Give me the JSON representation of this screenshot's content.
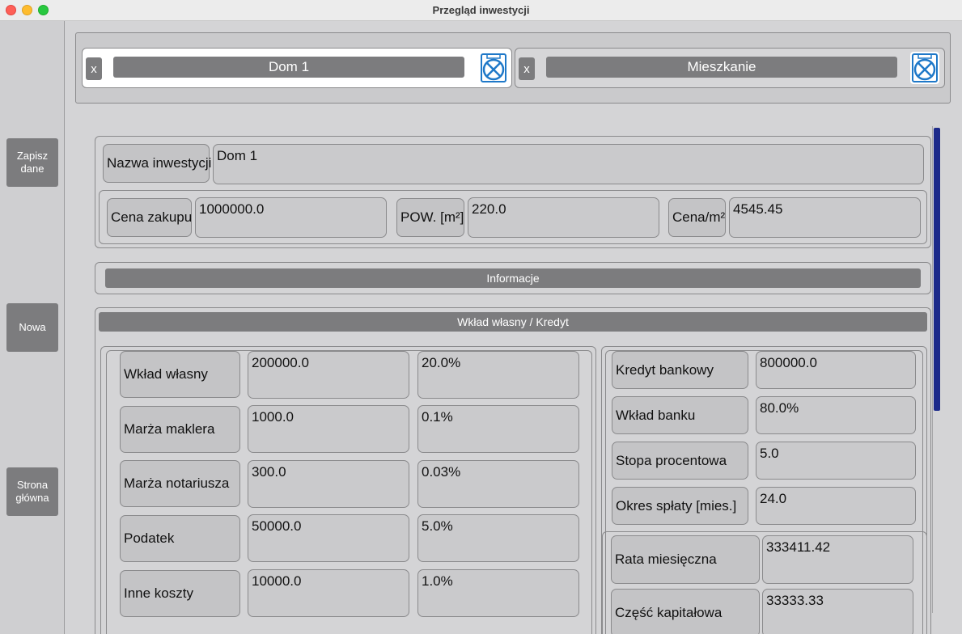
{
  "window": {
    "title": "Przegląd inwestycji"
  },
  "sidebar": {
    "save_label": "Zapisz dane",
    "new_label": "Nowa",
    "home_label": "Strona główna"
  },
  "tabs": [
    {
      "close_label": "x",
      "title": "Dom 1",
      "active": true
    },
    {
      "close_label": "x",
      "title": "Mieszkanie",
      "active": false
    }
  ],
  "investment": {
    "name_label": "Nazwa inwestycji",
    "name_value": "Dom 1",
    "price_label": "Cena zakupu",
    "price_value": "1000000.0",
    "area_label": "POW. [m²]",
    "area_value": "220.0",
    "price_per_m2_label": "Cena/m²",
    "price_per_m2_value": "4545.45"
  },
  "info_bar": "Informacje",
  "equity_section": {
    "title": "Wkład własny / Kredyt",
    "rows": [
      {
        "label": "Wkład własny",
        "amount": "200000.0",
        "percent": "20.0%"
      },
      {
        "label": "Marża maklera",
        "amount": "1000.0",
        "percent": "0.1%"
      },
      {
        "label": "Marża notariusza",
        "amount": "300.0",
        "percent": "0.03%"
      },
      {
        "label": "Podatek",
        "amount": "50000.0",
        "percent": "5.0%"
      },
      {
        "label": "Inne koszty",
        "amount": "10000.0",
        "percent": "1.0%"
      }
    ],
    "credit": [
      {
        "label": "Kredyt bankowy",
        "value": "800000.0"
      },
      {
        "label": "Wkład banku",
        "value": "80.0%"
      },
      {
        "label": "Stopa procentowa",
        "value": "5.0"
      },
      {
        "label": "Okres spłaty [mies.]",
        "value": "24.0"
      }
    ],
    "installment": [
      {
        "label": "Rata miesięczna",
        "value": "333411.42"
      },
      {
        "label": "Część kapitałowa",
        "value": "33333.33"
      }
    ]
  },
  "colors": {
    "button": "#7c7c7e",
    "scrollbar": "#1c2a8a",
    "background": "#d4d4d6"
  }
}
